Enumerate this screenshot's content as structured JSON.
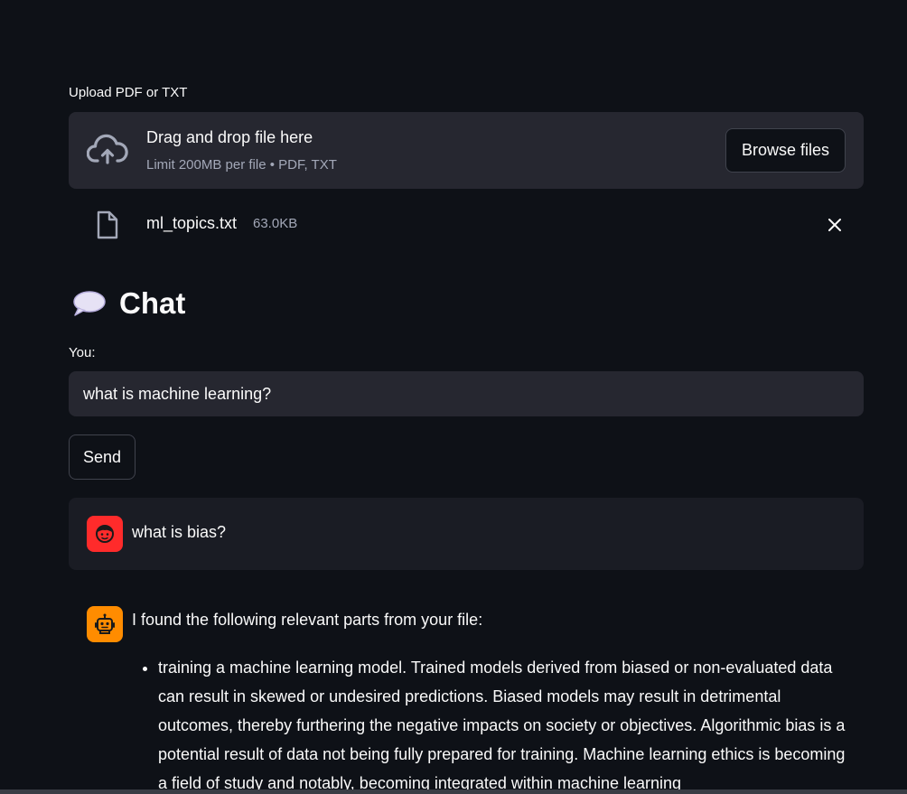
{
  "uploader": {
    "label": "Upload PDF or TXT",
    "drop_text": "Drag and drop file here",
    "limit_text": "Limit 200MB per file • PDF, TXT",
    "browse_label": "Browse files",
    "icon": "cloud-upload-icon"
  },
  "uploaded_file": {
    "name": "ml_topics.txt",
    "size": "63.0KB",
    "icon": "file-icon"
  },
  "chat": {
    "title": "Chat",
    "title_icon": "speech-bubble-icon",
    "input_label": "You:",
    "input_value": "what is machine learning?",
    "send_label": "Send"
  },
  "messages": {
    "user": {
      "text": "what is bias?",
      "avatar_color": "#ff2b2b"
    },
    "assistant": {
      "intro": "I found the following relevant parts from your file:",
      "avatar_color": "#ff8c00",
      "items": [
        "training a machine learning model. Trained models derived from biased or non-evaluated data can result in skewed or undesired predictions. Biased models may result in detrimental outcomes, thereby furthering the negative impacts on society or objectives. Algorithmic bias is a potential result of data not being fully prepared for training. Machine learning ethics is becoming a field of study and notably, becoming integrated within machine learning"
      ]
    }
  },
  "colors": {
    "background": "#0e1117",
    "surface": "#262730",
    "message_bg": "#1a1c24",
    "muted_text": "#a3a8b8"
  }
}
